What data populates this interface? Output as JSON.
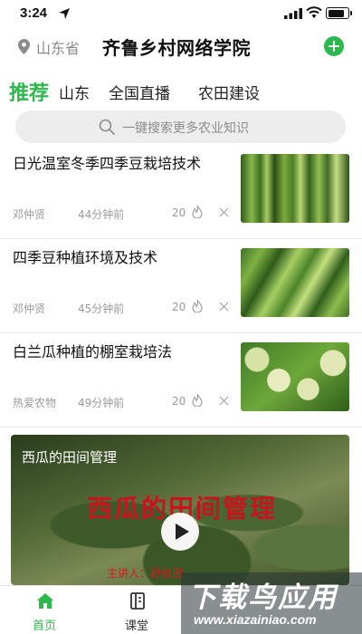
{
  "status_bar": {
    "time": "3:24",
    "battery_level": 0.85
  },
  "header": {
    "location": "山东省",
    "title": "齐鲁乡村网络学院",
    "add_icon": "plus-circle-icon"
  },
  "tabs": [
    {
      "label": "推荐",
      "active": true
    },
    {
      "label": "山东",
      "active": false
    },
    {
      "label": "全国直播",
      "active": false
    },
    {
      "label": "农田建设",
      "active": false
    }
  ],
  "search": {
    "placeholder": "一键搜索更多农业知识"
  },
  "articles": [
    {
      "title": "日光温室冬季四季豆栽培技术",
      "author": "邓仲贤",
      "time": "44分钟前",
      "heat": "20",
      "image": "green-beans-photo"
    },
    {
      "title": "四季豆种植环境及技术",
      "author": "邓仲贤",
      "time": "45分钟前",
      "heat": "20",
      "image": "bean-vines-photo"
    },
    {
      "title": "白兰瓜种植的棚室栽培法",
      "author": "热爱农物",
      "time": "49分钟前",
      "heat": "20",
      "image": "melons-photo"
    }
  ],
  "video": {
    "label": "西瓜的田间管理",
    "overlay_title": "西瓜的田间管理",
    "byline": "主讲人：孙世田"
  },
  "bottom_nav": [
    {
      "label": "首页",
      "icon": "home-icon",
      "active": true
    },
    {
      "label": "课堂",
      "icon": "classroom-icon",
      "active": false
    }
  ],
  "watermark": {
    "text": "下载鸟应用",
    "url": "www.xiazainiao.com"
  },
  "colors": {
    "accent": "#2db84d",
    "muted": "#9a9a9a",
    "search_bg": "#ededed"
  }
}
